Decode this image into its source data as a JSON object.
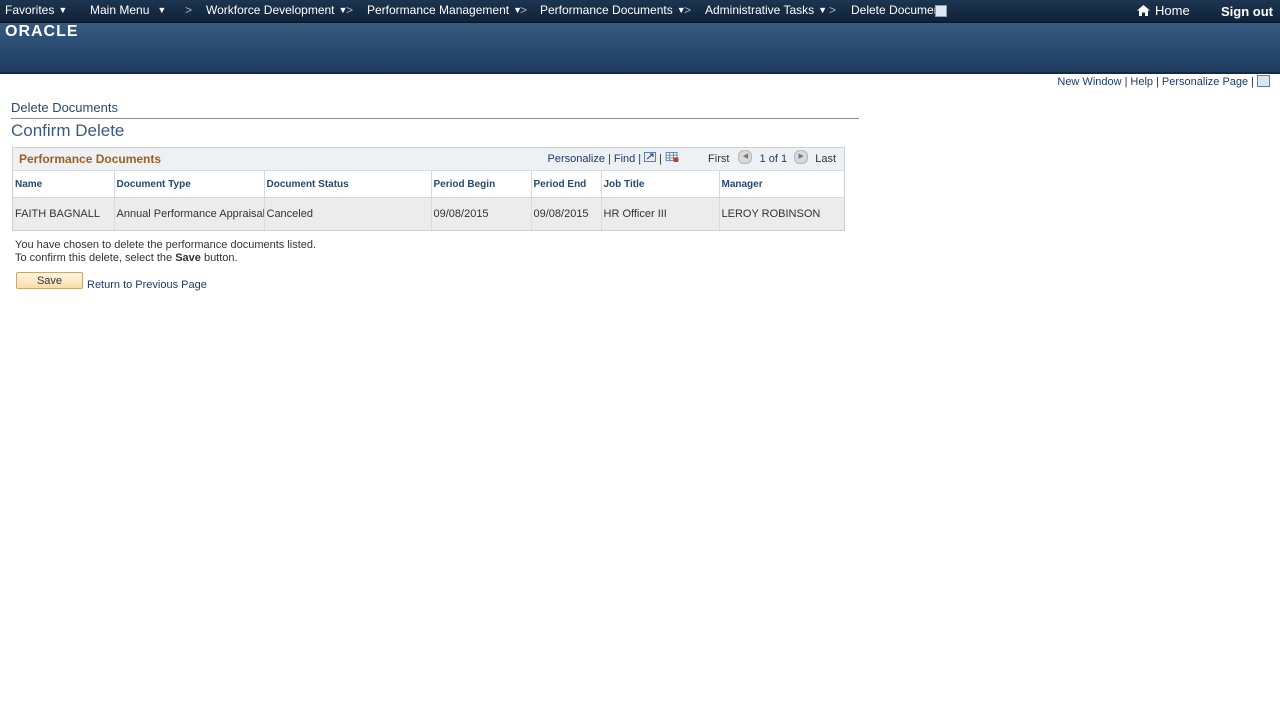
{
  "nav": {
    "favorites": "Favorites",
    "main_menu": "Main Menu",
    "sep": ">",
    "crumbs": [
      "Workforce Development",
      "Performance Management",
      "Performance Documents",
      "Administrative Tasks"
    ],
    "current": "Delete Documents",
    "home": "Home",
    "sign_out": "Sign out"
  },
  "brand": {
    "logo": "ORACLE"
  },
  "utility": {
    "new_window": "New Window",
    "help": "Help",
    "personalize_page": "Personalize Page",
    "bar": "|"
  },
  "page": {
    "breadcrumb": "Delete Documents",
    "title": "Confirm Delete"
  },
  "grid": {
    "title": "Performance Documents",
    "personalize": "Personalize",
    "find": "Find",
    "bar": "|",
    "first": "First",
    "range": "1 of 1",
    "last": "Last",
    "columns": [
      "Name",
      "Document Type",
      "Document Status",
      "Period Begin",
      "Period End",
      "Job Title",
      "Manager"
    ],
    "rows": [
      [
        "FAITH BAGNALL",
        "Annual Performance Appraisal",
        "Canceled",
        "09/08/2015",
        "09/08/2015",
        "HR Officer III",
        "LEROY ROBINSON"
      ]
    ]
  },
  "message": {
    "line1": "You have chosen to delete the performance documents listed.",
    "line2_pre": "To confirm this delete, select the ",
    "line2_bold": "Save",
    "line2_post": " button."
  },
  "actions": {
    "save": "Save",
    "return": "Return to Previous Page"
  },
  "colors": {
    "nav_bg": "#0f2238",
    "banner": "#2b4d72",
    "link": "#1d3b6e",
    "grid_title": "#a05d1f",
    "save_btn": "#f8dca7"
  }
}
